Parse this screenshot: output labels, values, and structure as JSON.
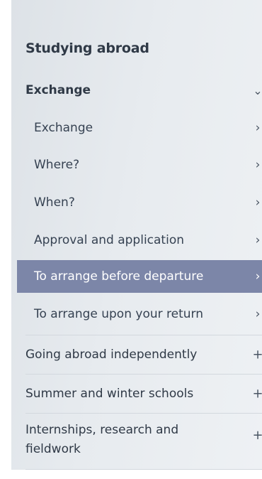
{
  "menu": {
    "heading": "Studying abroad",
    "parent": {
      "label": "Exchange",
      "indicator": "⌄"
    },
    "subitems": [
      {
        "label": "Exchange",
        "indicator": "›",
        "active": false
      },
      {
        "label": "Where?",
        "indicator": "›",
        "active": false
      },
      {
        "label": "When?",
        "indicator": "›",
        "active": false
      },
      {
        "label": "Approval and application",
        "indicator": "›",
        "active": false
      },
      {
        "label": "To arrange before departure",
        "indicator": "›",
        "active": true
      },
      {
        "label": "To arrange upon your return",
        "indicator": "›",
        "active": false
      }
    ],
    "sections": [
      {
        "label": "Going abroad independently",
        "indicator": "+"
      },
      {
        "label": "Summer and winter schools",
        "indicator": "+"
      },
      {
        "label": "Internships, research and fieldwork",
        "indicator": "+"
      }
    ],
    "colors": {
      "active_background": "#7c86a8",
      "text": "#2f3946"
    }
  }
}
